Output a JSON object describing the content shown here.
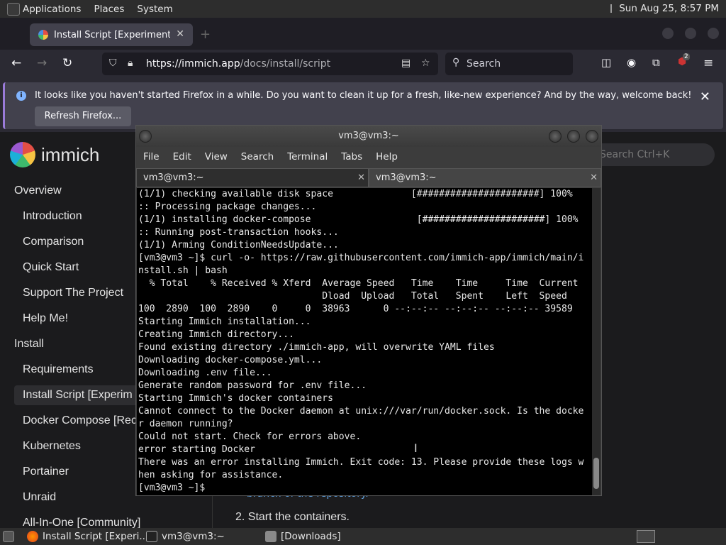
{
  "top_panel": {
    "menus": [
      "Applications",
      "Places",
      "System"
    ],
    "datetime": "Sun Aug 25,  8:57 PM"
  },
  "browser": {
    "tab_title": "Install Script [Experimental]",
    "url_host": "https://immich.app",
    "url_path": "/docs/install/script",
    "search_placeholder": "Search",
    "ublock_badge": "2",
    "notification": "It looks like you haven't started Firefox in a while. Do you want to clean it up for a fresh, like-new experience? And by the way, welcome back!",
    "refresh_button": "Refresh Firefox..."
  },
  "site": {
    "brand": "immich",
    "search_hint": "Search Ctrl+K",
    "sidebar": {
      "overview": "Overview",
      "introduction": "Introduction",
      "comparison": "Comparison",
      "quick_start": "Quick Start",
      "support": "Support The Project",
      "help": "Help Me!",
      "install": "Install",
      "requirements": "Requirements",
      "install_script": "Install Script [Experim",
      "docker_compose": "Docker Compose [Rec",
      "kubernetes": "Kubernetes",
      "portainer": "Portainer",
      "unraid": "Unraid",
      "all_in_one": "All-In-One [Community]"
    },
    "content_fragment": "branch of the repository.",
    "content_step": "2. Start the containers."
  },
  "terminal": {
    "title": "vm3@vm3:~",
    "menu": [
      "File",
      "Edit",
      "View",
      "Search",
      "Terminal",
      "Tabs",
      "Help"
    ],
    "tabs": [
      "vm3@vm3:~",
      "vm3@vm3:~"
    ],
    "output": "(1/1) checking available disk space              [######################] 100%\n:: Processing package changes...\n(1/1) installing docker-compose                   [######################] 100%\n:: Running post-transaction hooks...\n(1/1) Arming ConditionNeedsUpdate...\n[vm3@vm3 ~]$ curl -o- https://raw.githubusercontent.com/immich-app/immich/main/i\nnstall.sh | bash\n  % Total    % Received % Xferd  Average Speed   Time    Time     Time  Current\n                                 Dload  Upload   Total   Spent    Left  Speed\n100  2890  100  2890    0     0  38963      0 --:--:-- --:--:-- --:--:-- 39589\nStarting Immich installation...\nCreating Immich directory...\nFound existing directory ./immich-app, will overwrite YAML files\nDownloading docker-compose.yml...\nDownloading .env file...\nGenerate random password for .env file...\nStarting Immich's docker containers\nCannot connect to the Docker daemon at unix:///var/run/docker.sock. Is the docke\nr daemon running?\nCould not start. Check for errors above.\nerror starting Docker\nThere was an error installing Immich. Exit code: 13. Please provide these logs w\nhen asking for assistance.\n[vm3@vm3 ~]$"
  },
  "taskbar": {
    "items": [
      "Install Script [Experi...",
      "vm3@vm3:~",
      "[Downloads]"
    ]
  }
}
